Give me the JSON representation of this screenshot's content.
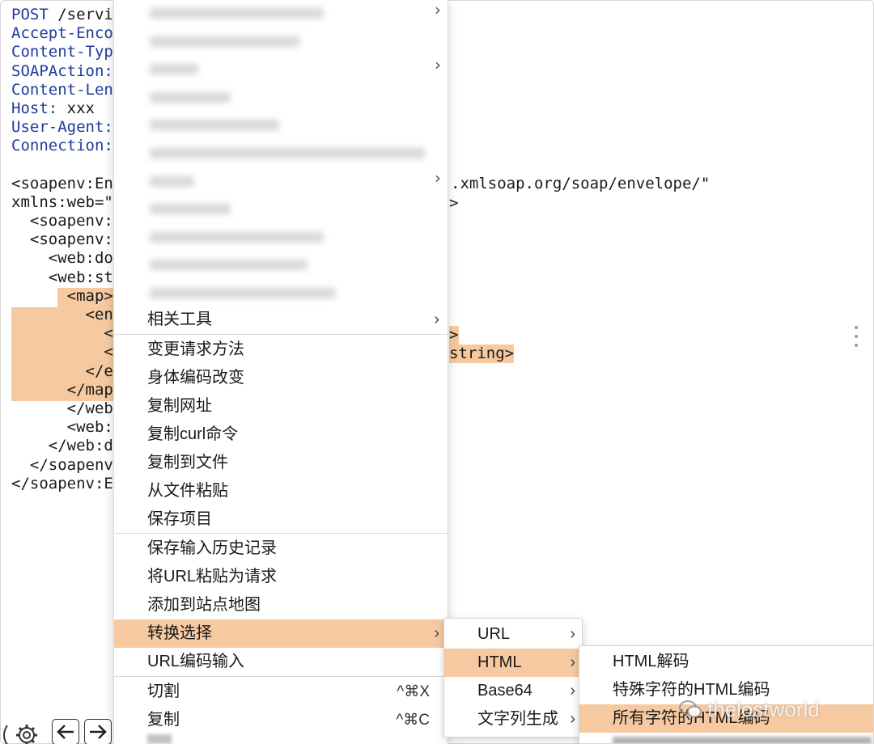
{
  "editor": {
    "lines": [
      {
        "k": "POST",
        "v": " /servi"
      },
      {
        "k": "Accept-Enco",
        "v": ""
      },
      {
        "k": "Content-Typ",
        "v": ""
      },
      {
        "k": "SOAPAction:",
        "v": ""
      },
      {
        "k": "Content-Len",
        "v": ""
      },
      {
        "k": "Host:",
        "v": " xxx"
      },
      {
        "k": "User-Agent:",
        "v": ""
      },
      {
        "k": "Connection:",
        "v": ""
      },
      {
        "k": "",
        "v": ""
      },
      {
        "k": "",
        "v": "<soapenv:En"
      },
      {
        "k": "",
        "v": "xmlns:web=\""
      },
      {
        "k": "",
        "v": "  <soapenv:"
      },
      {
        "k": "",
        "v": "  <soapenv:"
      },
      {
        "k": "",
        "v": "    <web:do"
      },
      {
        "k": "",
        "v": "    <web:st"
      },
      {
        "k": "",
        "v": "      <map>"
      },
      {
        "k": "",
        "v": "        <entr"
      },
      {
        "k": "",
        "v": "          <ur"
      },
      {
        "k": "",
        "v": "          <str"
      },
      {
        "k": "",
        "v": "        </ent"
      },
      {
        "k": "",
        "v": "      </map>"
      },
      {
        "k": "",
        "v": "      </web:"
      },
      {
        "k": "",
        "v": "      <web:s"
      },
      {
        "k": "",
        "v": "    </web:d"
      },
      {
        "k": "",
        "v": "  </soapenv"
      },
      {
        "k": "",
        "v": "</soapenv:E"
      }
    ],
    "right_fragments": {
      "envelope": ".xmlsoap.org/soap/envelope/\"",
      "gt": ">",
      "gt2": ">",
      "string_close": "string>"
    }
  },
  "context_menu": {
    "items": [
      {
        "label": "相关工具",
        "submenu": true
      },
      {
        "label": "变更请求方法"
      },
      {
        "label": "身体编码改变"
      },
      {
        "label": "复制网址"
      },
      {
        "label": "复制curl命令"
      },
      {
        "label": "复制到文件"
      },
      {
        "label": "从文件粘贴"
      },
      {
        "label": "保存项目"
      },
      {
        "label": "保存输入历史记录"
      },
      {
        "label": "将URL粘贴为请求"
      },
      {
        "label": "添加到站点地图"
      },
      {
        "label": "转换选择",
        "submenu": true,
        "active": true
      },
      {
        "label": "URL编码输入"
      },
      {
        "label": "切割",
        "shortcut": "^⌘X"
      },
      {
        "label": "复制",
        "shortcut": "^⌘C"
      }
    ]
  },
  "convert_submenu": {
    "items": [
      {
        "label": "URL"
      },
      {
        "label": "HTML",
        "active": true
      },
      {
        "label": "Base64"
      },
      {
        "label": "文字列生成"
      }
    ]
  },
  "html_submenu": {
    "items": [
      {
        "label": "HTML解码"
      },
      {
        "label": "特殊字符的HTML编码"
      },
      {
        "label": "所有字符的HTML编码",
        "active": true
      }
    ]
  },
  "watermark": "thelostworld",
  "icons": {
    "gear": "gear-icon",
    "back": "arrow-left-icon",
    "forward": "arrow-right-icon",
    "chevron": "›",
    "more": "kebab-icon"
  },
  "colors": {
    "highlight": "#f6c9a0",
    "header_key": "#1d3b9e"
  }
}
